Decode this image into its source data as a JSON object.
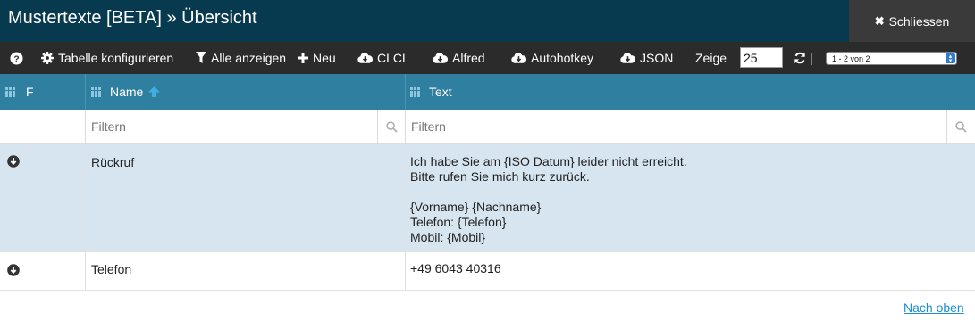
{
  "window": {
    "title": "Mustertexte [BETA] » Übersicht",
    "close_label": "Schliessen"
  },
  "toolbar": {
    "help_icon": "question-circle-icon",
    "configure_label": "Tabelle konfigurieren",
    "show_all_label": "Alle anzeigen",
    "new_label": "Neu",
    "export_clcl_label": "CLCL",
    "export_alfred_label": "Alfred",
    "export_autohotkey_label": "Autohotkey",
    "export_json_label": "JSON",
    "show_label": "Zeige",
    "page_size_value": "25",
    "separator": "|",
    "pager_value": "1 - 2 von 2"
  },
  "table": {
    "columns": {
      "flag": "F",
      "name": "Name",
      "text": "Text"
    },
    "filters": {
      "name_placeholder": "Filtern",
      "text_placeholder": "Filtern"
    },
    "rows": [
      {
        "name": "Rückruf",
        "text_lines": [
          "Ich habe Sie am {ISO Datum} leider nicht erreicht.",
          "Bitte rufen Sie mich kurz zurück.",
          "",
          "{Vorname} {Nachname}",
          "Telefon: {Telefon}",
          "Mobil: {Mobil}"
        ],
        "selected": true
      },
      {
        "name": "Telefon",
        "text_lines": [
          "+49 6043 40316"
        ],
        "selected": false
      }
    ]
  },
  "footer": {
    "back_to_top_label": "Nach oben"
  },
  "colors": {
    "title_bg": "#083a4f",
    "toolbar_bg": "#2b2b2b",
    "header_bg": "#2f7fa0",
    "selected_row_bg": "#d6e5f0",
    "link": "#1a8ecf"
  }
}
